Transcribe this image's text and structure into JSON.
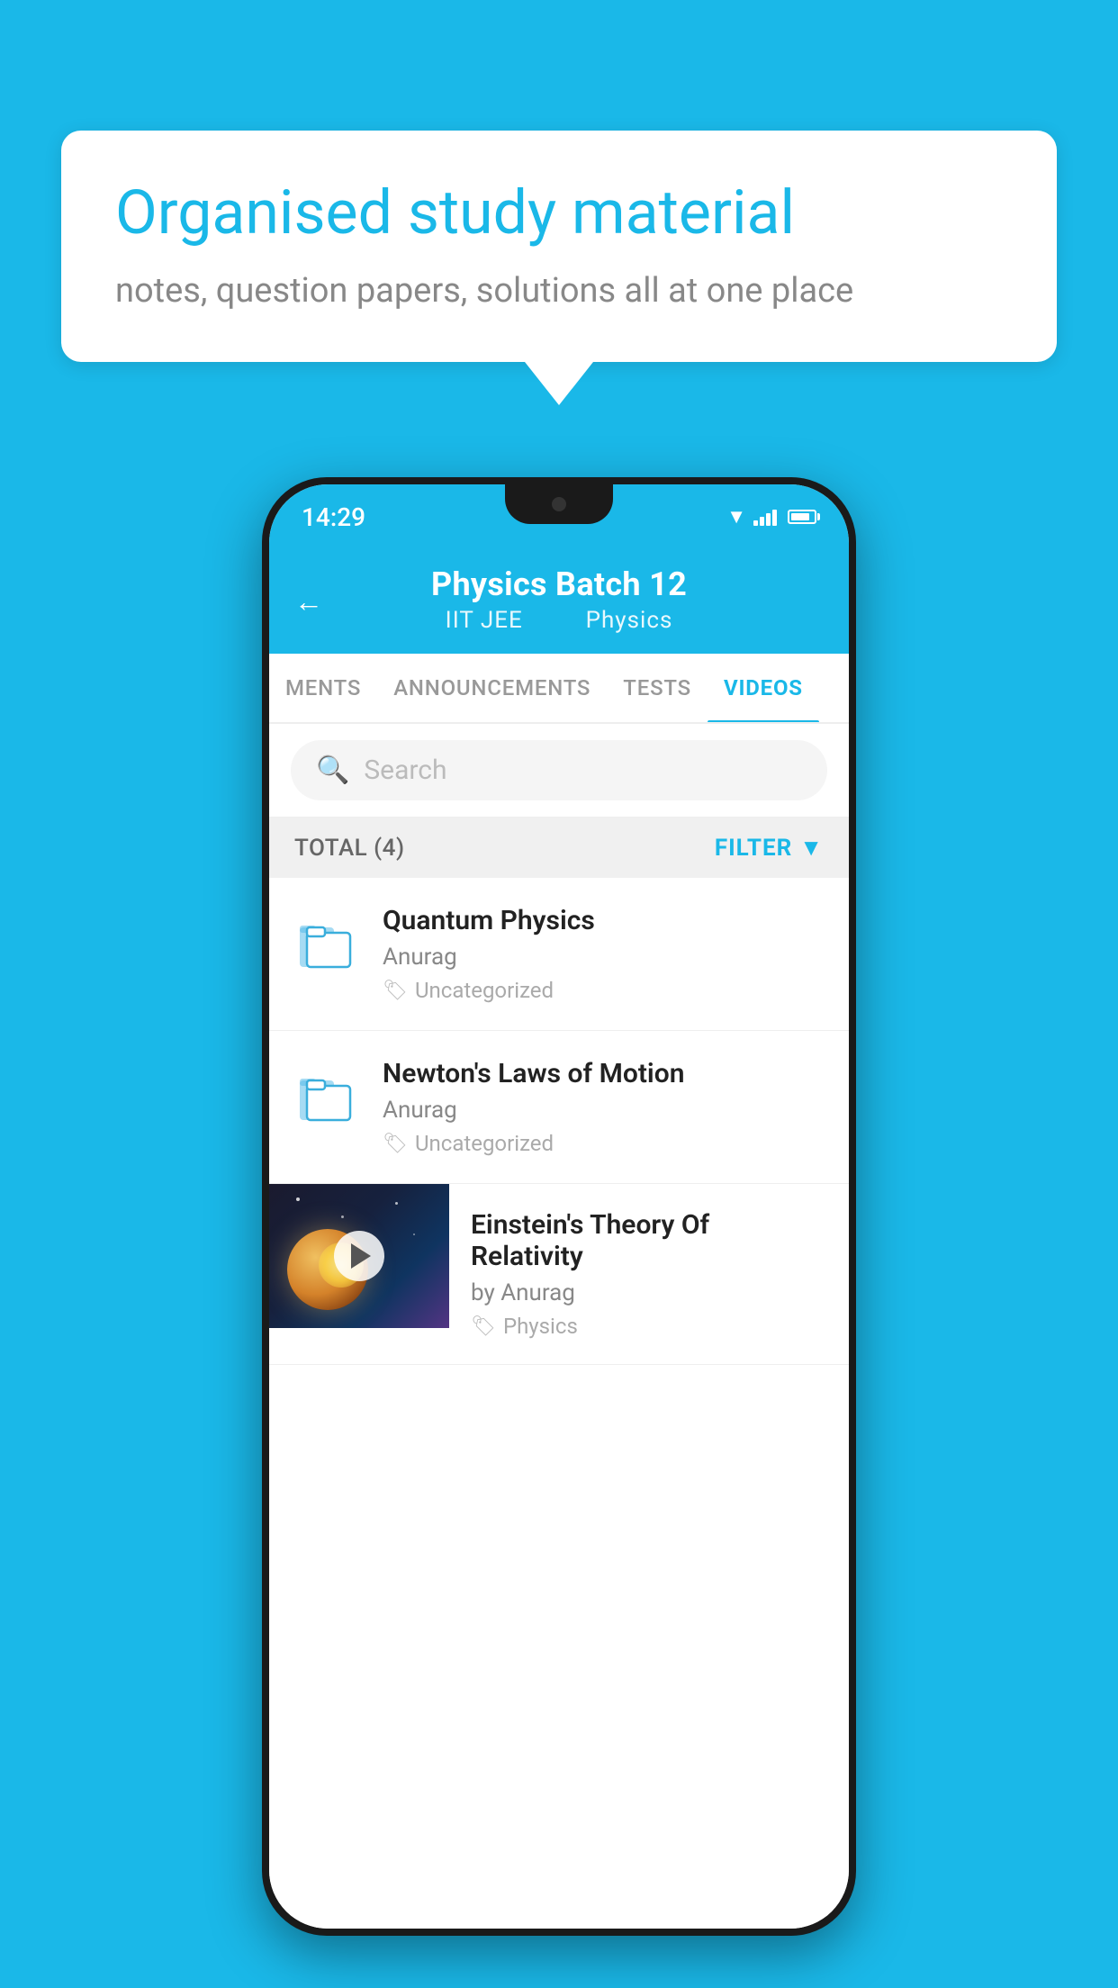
{
  "background_color": "#1ab8e8",
  "speech_bubble": {
    "title": "Organised study material",
    "subtitle": "notes, question papers, solutions all at one place"
  },
  "status_bar": {
    "time": "14:29"
  },
  "app_header": {
    "back_label": "←",
    "title": "Physics Batch 12",
    "subtitle_part1": "IIT JEE",
    "subtitle_part2": "Physics"
  },
  "tabs": [
    {
      "label": "MENTS",
      "active": false
    },
    {
      "label": "ANNOUNCEMENTS",
      "active": false
    },
    {
      "label": "TESTS",
      "active": false
    },
    {
      "label": "VIDEOS",
      "active": true
    }
  ],
  "search": {
    "placeholder": "Search"
  },
  "filter_bar": {
    "total_label": "TOTAL (4)",
    "filter_label": "FILTER"
  },
  "video_items": [
    {
      "id": 1,
      "title": "Quantum Physics",
      "author": "Anurag",
      "tag": "Uncategorized",
      "has_thumbnail": false
    },
    {
      "id": 2,
      "title": "Newton's Laws of Motion",
      "author": "Anurag",
      "tag": "Uncategorized",
      "has_thumbnail": false
    },
    {
      "id": 3,
      "title": "Einstein's Theory Of Relativity",
      "author": "by Anurag",
      "tag": "Physics",
      "has_thumbnail": true
    }
  ]
}
